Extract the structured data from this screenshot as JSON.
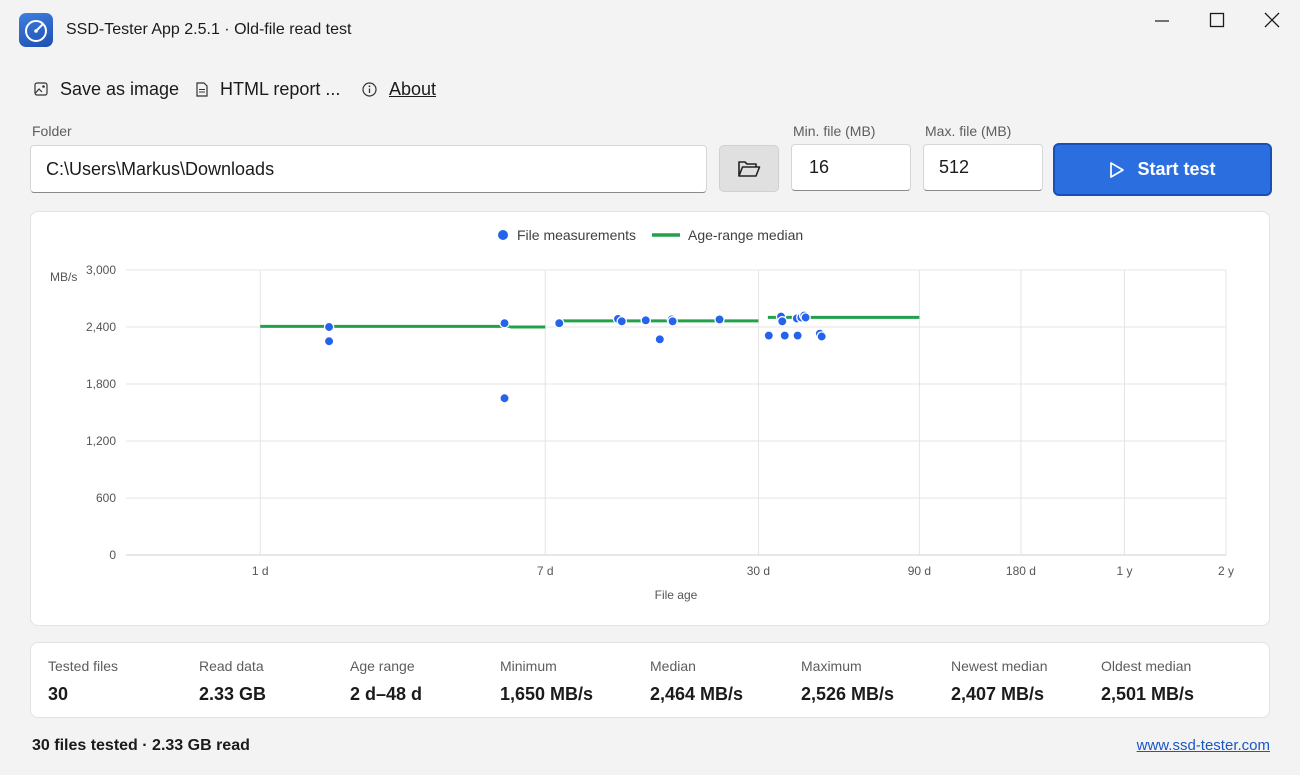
{
  "window": {
    "title": "SSD-Tester App 2.5.1 · Old-file read test"
  },
  "menu": {
    "items": [
      {
        "label": "Save as image",
        "icon": "image-icon"
      },
      {
        "label": "HTML report ...",
        "icon": "document-icon"
      },
      {
        "label": "About",
        "icon": "info-icon"
      }
    ]
  },
  "form": {
    "folder_label": "Folder",
    "folder_value": "C:\\Users\\Markus\\Downloads",
    "min_label": "Min. file (MB)",
    "min_value": "16",
    "max_label": "Max. file (MB)",
    "max_value": "512",
    "start_label": "Start test"
  },
  "colors": {
    "accent": "#2a6ee0",
    "points": "#2563eb",
    "median": "#22a04b"
  },
  "chart_data": {
    "type": "scatter",
    "title": "",
    "xlabel": "File age",
    "ylabel": "MB/s",
    "ylim": [
      0,
      3000
    ],
    "y_ticks": [
      "0",
      "600",
      "1,200",
      "1,800",
      "2,400",
      "3,000"
    ],
    "y_tick_values": [
      0,
      600,
      1200,
      1800,
      2400,
      3000
    ],
    "x_scale": "log (days)",
    "x_ticks": [
      "1 d",
      "7 d",
      "30 d",
      "90 d",
      "180 d",
      "1 y",
      "2 y"
    ],
    "x_tick_days": [
      1,
      7,
      30,
      90,
      180,
      365,
      730
    ],
    "xlim_days": [
      0.4,
      730
    ],
    "grid": true,
    "legend_position": "top-center",
    "legend": [
      "File measurements",
      "Age-range median"
    ],
    "series": [
      {
        "name": "File measurements",
        "kind": "points",
        "points": [
          {
            "x": 1.6,
            "y": 2400
          },
          {
            "x": 1.6,
            "y": 2250
          },
          {
            "x": 5.3,
            "y": 2440
          },
          {
            "x": 5.3,
            "y": 1650
          },
          {
            "x": 7.7,
            "y": 2440
          },
          {
            "x": 11.5,
            "y": 2485
          },
          {
            "x": 11.8,
            "y": 2460
          },
          {
            "x": 13.9,
            "y": 2470
          },
          {
            "x": 15.3,
            "y": 2270
          },
          {
            "x": 16.6,
            "y": 2480
          },
          {
            "x": 16.7,
            "y": 2460
          },
          {
            "x": 23.0,
            "y": 2480
          },
          {
            "x": 32.2,
            "y": 2310
          },
          {
            "x": 35.0,
            "y": 2510
          },
          {
            "x": 35.3,
            "y": 2460
          },
          {
            "x": 35.9,
            "y": 2310
          },
          {
            "x": 39.0,
            "y": 2490
          },
          {
            "x": 39.2,
            "y": 2310
          },
          {
            "x": 40.2,
            "y": 2500
          },
          {
            "x": 41.0,
            "y": 2520
          },
          {
            "x": 41.4,
            "y": 2500
          },
          {
            "x": 45.6,
            "y": 2330
          },
          {
            "x": 46.2,
            "y": 2300
          }
        ]
      },
      {
        "name": "Age-range median",
        "kind": "segments",
        "segments": [
          {
            "x1": 1,
            "x2": 5.5,
            "y": 2407
          },
          {
            "x1": 5.5,
            "x2": 7.0,
            "y": 2400
          },
          {
            "x1": 7.8,
            "x2": 30.0,
            "y": 2465
          },
          {
            "x1": 32.0,
            "x2": 90.0,
            "y": 2501
          }
        ]
      }
    ]
  },
  "stats": [
    {
      "title": "Tested files",
      "value": "30"
    },
    {
      "title": "Read data",
      "value": "2.33 GB"
    },
    {
      "title": "Age range",
      "value": "2 d–48 d"
    },
    {
      "title": "Minimum",
      "value": "1,650 MB/s"
    },
    {
      "title": "Median",
      "value": "2,464 MB/s"
    },
    {
      "title": "Maximum",
      "value": "2,526 MB/s"
    },
    {
      "title": "Newest median",
      "value": "2,407 MB/s"
    },
    {
      "title": "Oldest median",
      "value": "2,501 MB/s"
    }
  ],
  "status": {
    "text": "30 files tested · 2.33 GB read",
    "link": "www.ssd-tester.com"
  }
}
